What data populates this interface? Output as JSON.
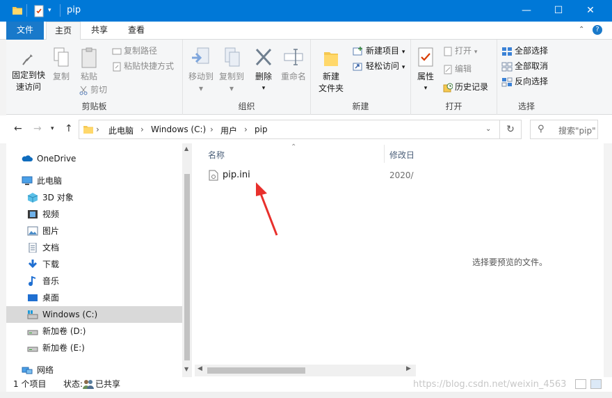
{
  "window": {
    "title": "pip",
    "controls": {
      "minimize": "—",
      "maximize": "☐",
      "close": "✕"
    }
  },
  "ribbon_tabs": [
    "文件",
    "主页",
    "共享",
    "查看"
  ],
  "ribbon": {
    "clipboard": {
      "label": "剪贴板",
      "pin": "固定到快速访问",
      "pin_line1": "固定到快",
      "pin_line2": "速访问",
      "copy": "复制",
      "paste": "粘贴",
      "copy_path": "复制路径",
      "paste_shortcut": "粘贴快捷方式",
      "cut": "剪切"
    },
    "organize": {
      "label": "组织",
      "move_to": "移动到",
      "copy_to": "复制到",
      "delete": "删除",
      "rename": "重命名"
    },
    "new": {
      "label": "新建",
      "new_folder_line1": "新建",
      "new_folder_line2": "文件夹",
      "new_item": "新建项目",
      "easy_access": "轻松访问"
    },
    "open": {
      "label": "打开",
      "properties": "属性",
      "open": "打开",
      "edit": "编辑",
      "history": "历史记录"
    },
    "select": {
      "label": "选择",
      "select_all": "全部选择",
      "select_none": "全部取消",
      "invert": "反向选择"
    }
  },
  "address": {
    "crumbs": [
      "此电脑",
      "Windows (C:)",
      "用户",
      "pip"
    ],
    "search_placeholder": "搜索\"pip\""
  },
  "nav": {
    "onedrive": "OneDrive",
    "this_pc": "此电脑",
    "objects3d": "3D 对象",
    "videos": "视频",
    "pictures": "图片",
    "documents": "文档",
    "downloads": "下载",
    "music": "音乐",
    "desktop": "桌面",
    "drive_c": "Windows (C:)",
    "drive_d": "新加卷 (D:)",
    "drive_e": "新加卷 (E:)",
    "network": "网络"
  },
  "content": {
    "col_name": "名称",
    "col_modified": "修改日",
    "files": [
      {
        "name": "pip.ini",
        "modified": "2020/"
      }
    ]
  },
  "preview": {
    "text": "选择要预览的文件。"
  },
  "status": {
    "count": "1 个项目",
    "state_label": "状态:",
    "state_value": "已共享"
  },
  "watermark": "https://blog.csdn.net/weixin_4563",
  "colors": {
    "accent": "#0078d7",
    "arrow": "#e8302c",
    "folder": "#f5c851"
  }
}
